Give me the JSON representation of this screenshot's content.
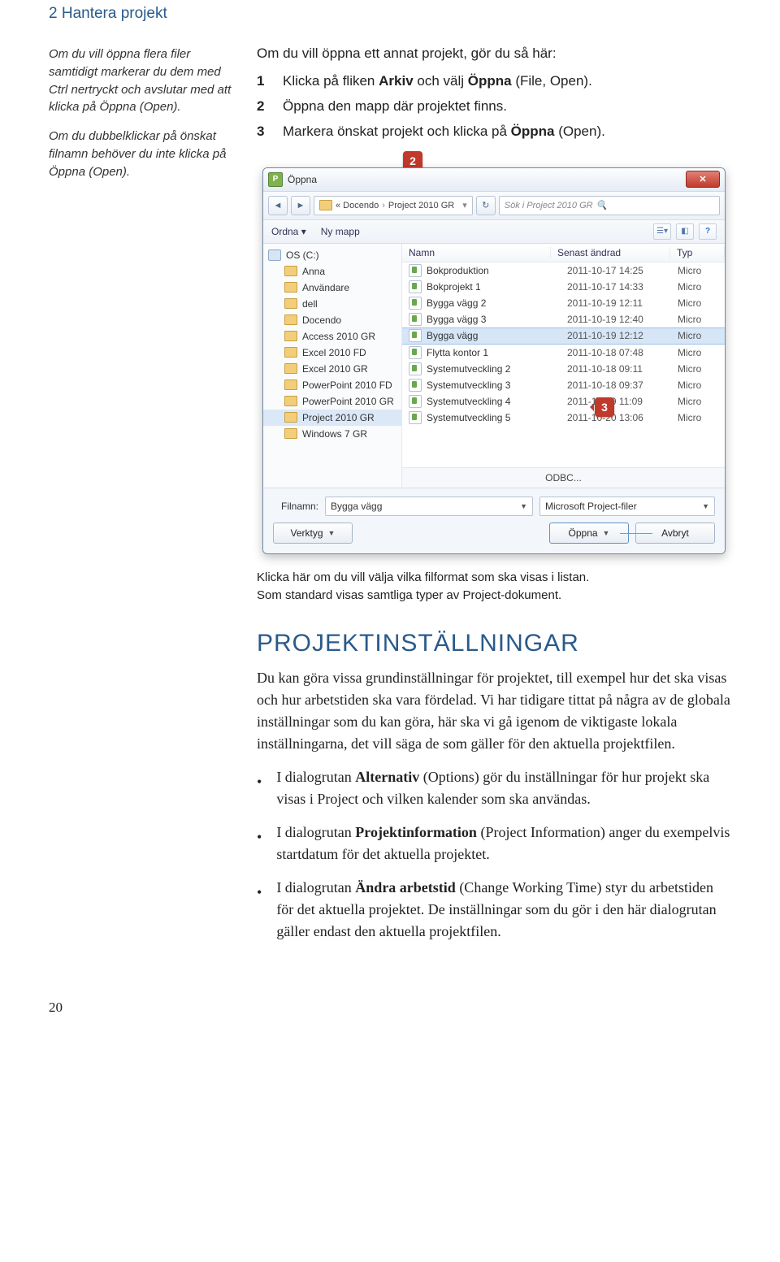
{
  "chapter": "2  Hantera projekt",
  "sidebar": {
    "p1": "Om du vill öppna flera filer samtidigt markerar du dem med Ctrl nertryckt och avslutar med att klicka på Öppna (Open).",
    "p2": "Om du dubbelklickar på önskat filnamn behöver du inte klicka på Öppna (Open)."
  },
  "intro": "Om du vill öppna ett annat projekt, gör du så här:",
  "steps": {
    "s1": "Klicka på fliken Arkiv och välj Öppna (File, Open).",
    "s2": "Öppna den mapp där projektet finns.",
    "s3": "Markera önskat projekt och klicka på Öppna (Open)."
  },
  "callouts": {
    "c2": "2",
    "c3": "3"
  },
  "dialog": {
    "title": "Öppna",
    "breadcrumb_prefix": "« Docendo",
    "breadcrumb_last": "Project 2010 GR",
    "search_placeholder": "Sök i Project 2010 GR",
    "toolbar": {
      "ordna": "Ordna",
      "nymapp": "Ny mapp"
    },
    "columns": {
      "name": "Namn",
      "date": "Senast ändrad",
      "type": "Typ"
    },
    "odbc": "ODBC...",
    "filnamn_label": "Filnamn:",
    "filnamn_value": "Bygga vägg",
    "filetype_value": "Microsoft Project-filer",
    "verktyg": "Verktyg",
    "open_btn": "Öppna",
    "cancel_btn": "Avbryt",
    "drive": "OS (C:)",
    "tree": [
      "Anna",
      "Användare",
      "dell",
      "Docendo",
      "Access 2010 GR",
      "Excel 2010 FD",
      "Excel 2010 GR",
      "PowerPoint 2010 FD",
      "PowerPoint 2010 GR",
      "Project 2010 GR",
      "Windows 7 GR"
    ],
    "files": [
      {
        "n": "Bokproduktion",
        "d": "2011-10-17 14:25",
        "t": "Micro"
      },
      {
        "n": "Bokprojekt 1",
        "d": "2011-10-17 14:33",
        "t": "Micro"
      },
      {
        "n": "Bygga vägg 2",
        "d": "2011-10-19 12:11",
        "t": "Micro"
      },
      {
        "n": "Bygga vägg 3",
        "d": "2011-10-19 12:40",
        "t": "Micro"
      },
      {
        "n": "Bygga vägg",
        "d": "2011-10-19 12:12",
        "t": "Micro",
        "sel": true
      },
      {
        "n": "Flytta kontor 1",
        "d": "2011-10-18 07:48",
        "t": "Micro"
      },
      {
        "n": "Systemutveckling 2",
        "d": "2011-10-18 09:11",
        "t": "Micro"
      },
      {
        "n": "Systemutveckling 3",
        "d": "2011-10-18 09:37",
        "t": "Micro"
      },
      {
        "n": "Systemutveckling 4",
        "d": "2011-10-19 11:09",
        "t": "Micro"
      },
      {
        "n": "Systemutveckling 5",
        "d": "2011-10-20 13:06",
        "t": "Micro"
      }
    ]
  },
  "caption": {
    "l1": "Klicka här om du vill välja vilka filformat som ska visas i listan.",
    "l2": "Som standard visas samtliga typer av Project-dokument."
  },
  "section": "PROJEKTINSTÄLLNINGAR",
  "para": "Du kan göra vissa grundinställningar för projektet, till exempel hur det ska visas och hur arbetstiden ska vara fördelad. Vi har tidigare tittat på några av de globala inställningar som du kan göra, här ska vi gå igenom de viktigaste lokala inställningarna, det vill säga de som gäller för den aktuella projektfilen.",
  "bullets": {
    "b1": "I dialogrutan Alternativ (Options) gör du inställningar för hur projekt ska visas i Project och vilken kalender som ska användas.",
    "b2": "I dialogrutan Projektinformation (Project Information) anger du exempelvis startdatum för det aktuella projektet.",
    "b3": "I dialogrutan Ändra arbetstid (Change Working Time) styr du arbetstiden för det aktuella projektet. De inställningar som du gör i den här dialogrutan gäller endast den aktuella projektfilen."
  },
  "bold": {
    "arkiv": "Arkiv",
    "oppna": "Öppna",
    "file_open": "(File, Open)",
    "open": "(Open)",
    "alt": "Alternativ",
    "proj": "Projektinformation",
    "andra": "Ändra arbetstid"
  },
  "pagenum": "20"
}
